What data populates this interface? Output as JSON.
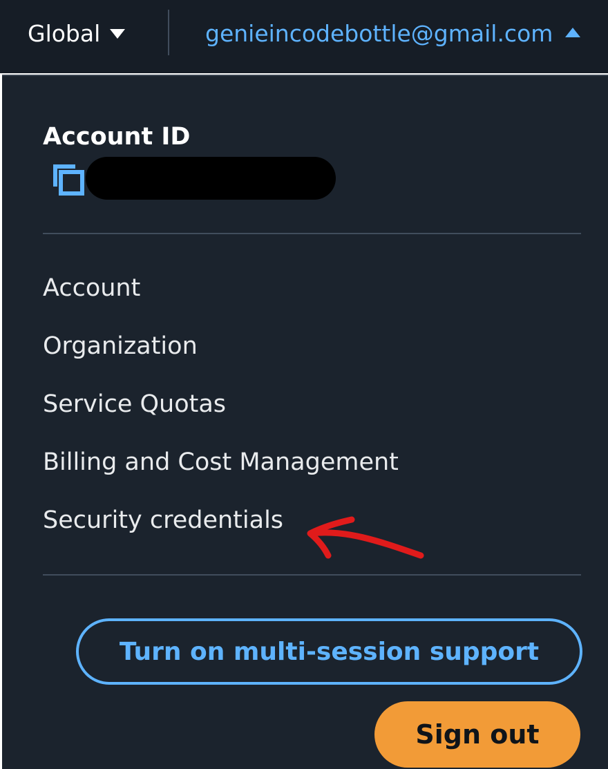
{
  "topbar": {
    "region_label": "Global",
    "account_email": "genieincodebottle@gmail.com"
  },
  "account_menu": {
    "account_id_label": "Account ID",
    "items": [
      {
        "label": "Account"
      },
      {
        "label": "Organization"
      },
      {
        "label": "Service Quotas"
      },
      {
        "label": "Billing and Cost Management"
      },
      {
        "label": "Security credentials"
      }
    ],
    "multi_session_button": "Turn on multi-session support",
    "sign_out_button": "Sign out"
  },
  "icons": {
    "region_caret": "caret-down-icon",
    "account_caret": "caret-up-icon",
    "copy": "copy-icon"
  },
  "colors": {
    "topbar_bg": "#161d26",
    "menu_bg": "#1b232d",
    "link_blue": "#5eb3ff",
    "sign_out_orange": "#f29b37",
    "annotation_red": "#e01b1b"
  }
}
